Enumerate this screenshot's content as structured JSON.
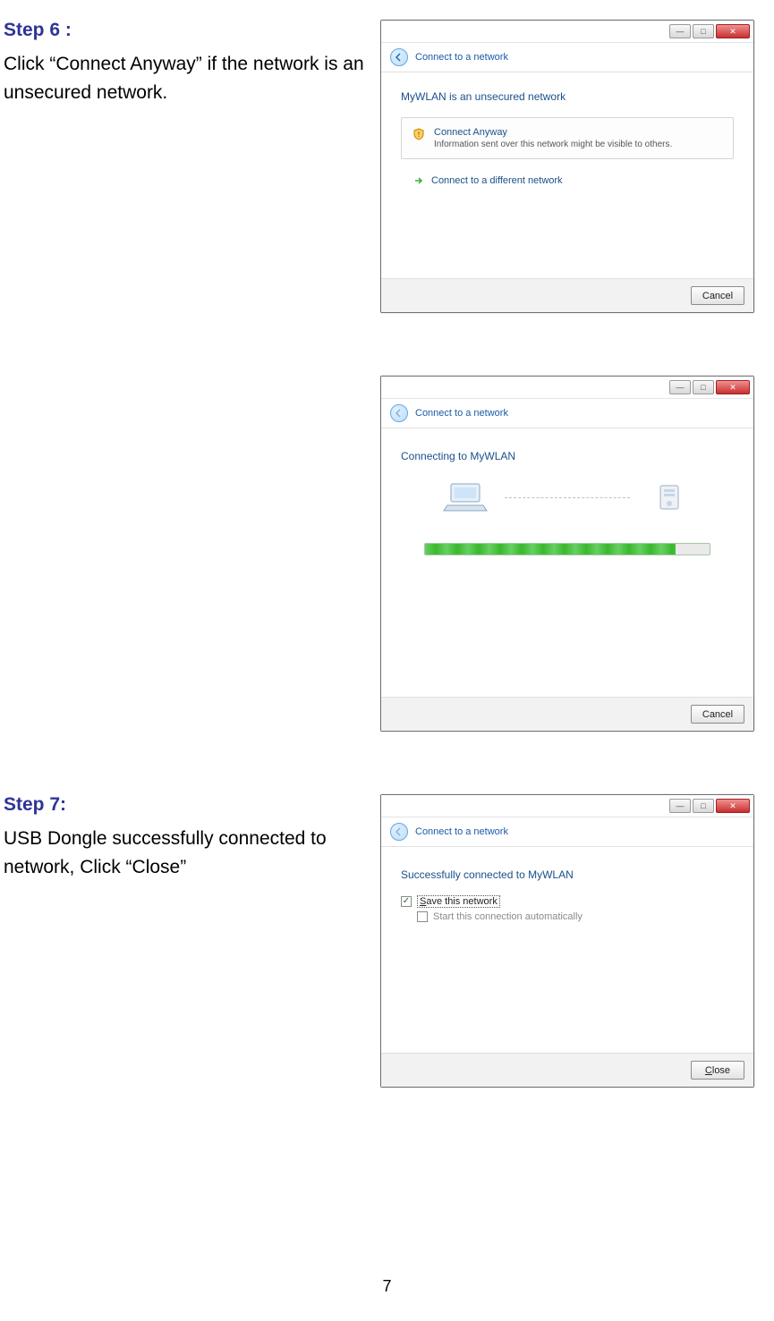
{
  "steps": {
    "s6_title": "Step 6 :",
    "s6_body": "Click “Connect Anyway” if the network is an unsecured network.",
    "s7_title": "Step 7:",
    "s7_body": "USB Dongle successfully connected to network, Click “Close”"
  },
  "dialog1": {
    "subtitle": "Connect to a network",
    "heading": "MyWLAN is an unsecured network",
    "opt_title": "Connect Anyway",
    "opt_sub": "Information sent over this network might be visible to others.",
    "link": "Connect to a different network",
    "cancel": "Cancel"
  },
  "dialog2": {
    "subtitle": "Connect to a network",
    "heading": "Connecting to MyWLAN",
    "cancel": "Cancel"
  },
  "dialog3": {
    "subtitle": "Connect to a network",
    "heading": "Successfully connected to MyWLAN",
    "save_pre": "S",
    "save_rest": "ave this network",
    "auto": "Start this connection automatically",
    "close_pre": "C",
    "close_rest": "lose"
  },
  "page_number": "7"
}
